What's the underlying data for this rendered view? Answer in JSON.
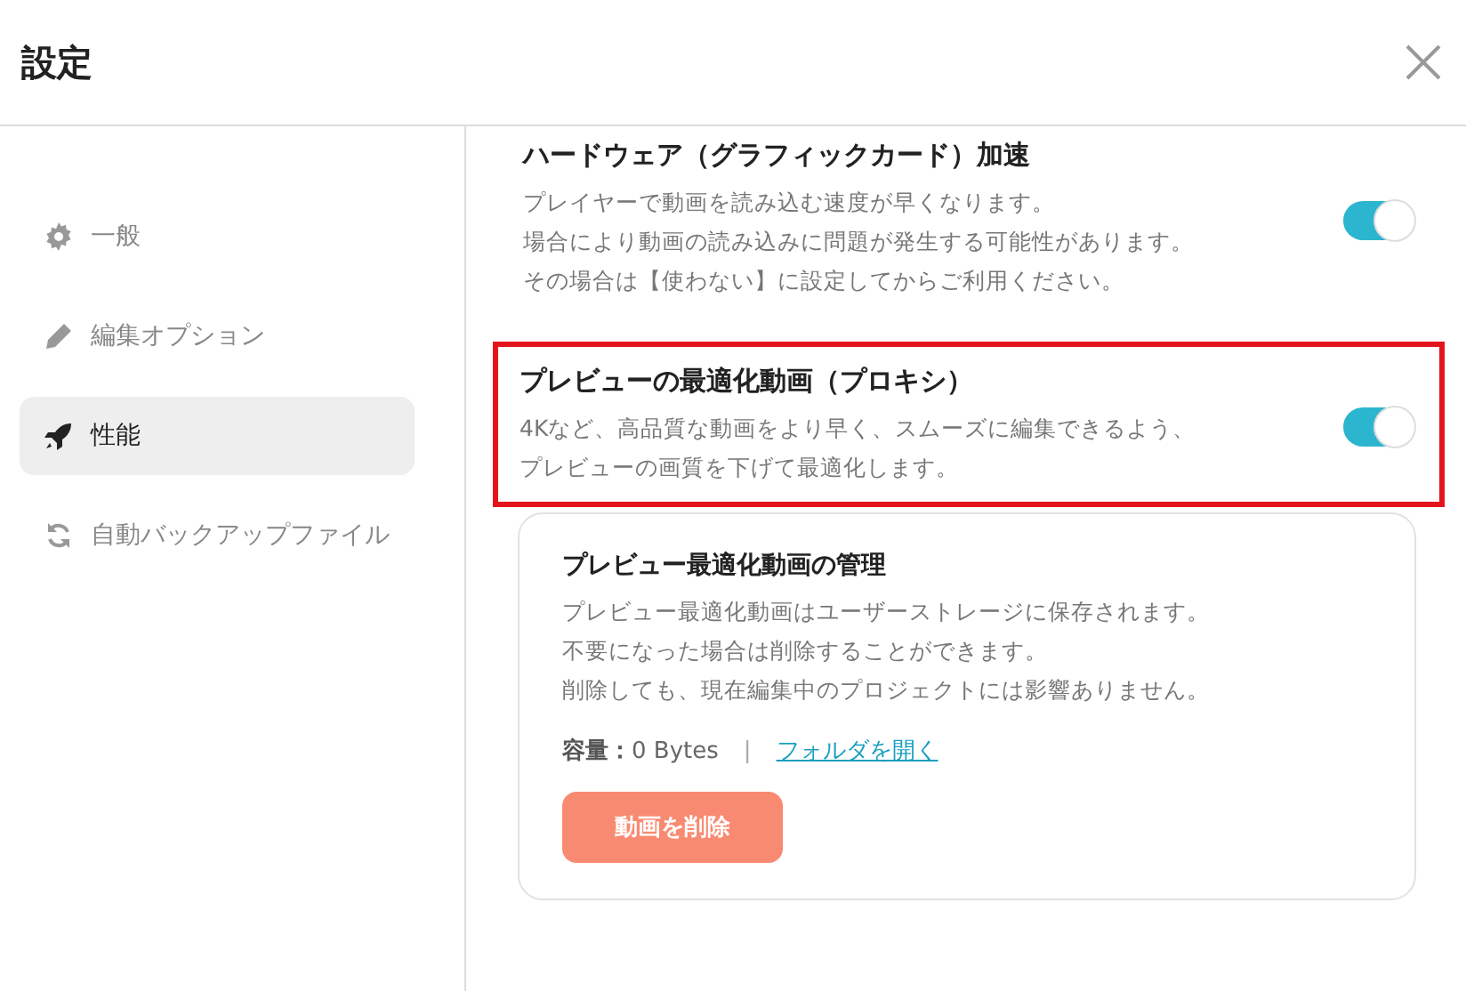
{
  "window": {
    "title": "設定"
  },
  "sidebar": {
    "items": [
      {
        "label": "一般",
        "selected": false
      },
      {
        "label": "編集オプション",
        "selected": false
      },
      {
        "label": "性能",
        "selected": true
      },
      {
        "label": "自動バックアップファイル",
        "selected": false
      }
    ]
  },
  "settings": [
    {
      "title": "ハードウェア（グラフィックカード）加速",
      "description": [
        "プレイヤーで動画を読み込む速度が早くなります。",
        "場合により動画の読み込みに問題が発生する可能性があります。",
        "その場合は【使わない】に設定してからご利用ください。"
      ],
      "on": true,
      "highlighted": false
    },
    {
      "title": "プレビューの最適化動画（プロキシ）",
      "description": [
        "4Kなど、高品質な動画をより早く、スムーズに編集できるよう、",
        "プレビューの画質を下げて最適化します。"
      ],
      "on": true,
      "highlighted": true
    }
  ],
  "storage_card": {
    "title": "プレビュー最適化動画の管理",
    "description": [
      "プレビュー最適化動画はユーザーストレージに保存されます。",
      "不要になった場合は削除することができます。",
      "削除しても、現在編集中のプロジェクトには影響ありません。"
    ],
    "capacity_label": "容量：",
    "capacity_value": "0 Bytes",
    "separator": "|",
    "link": "フォルダを開く",
    "button": "動画を削除"
  }
}
